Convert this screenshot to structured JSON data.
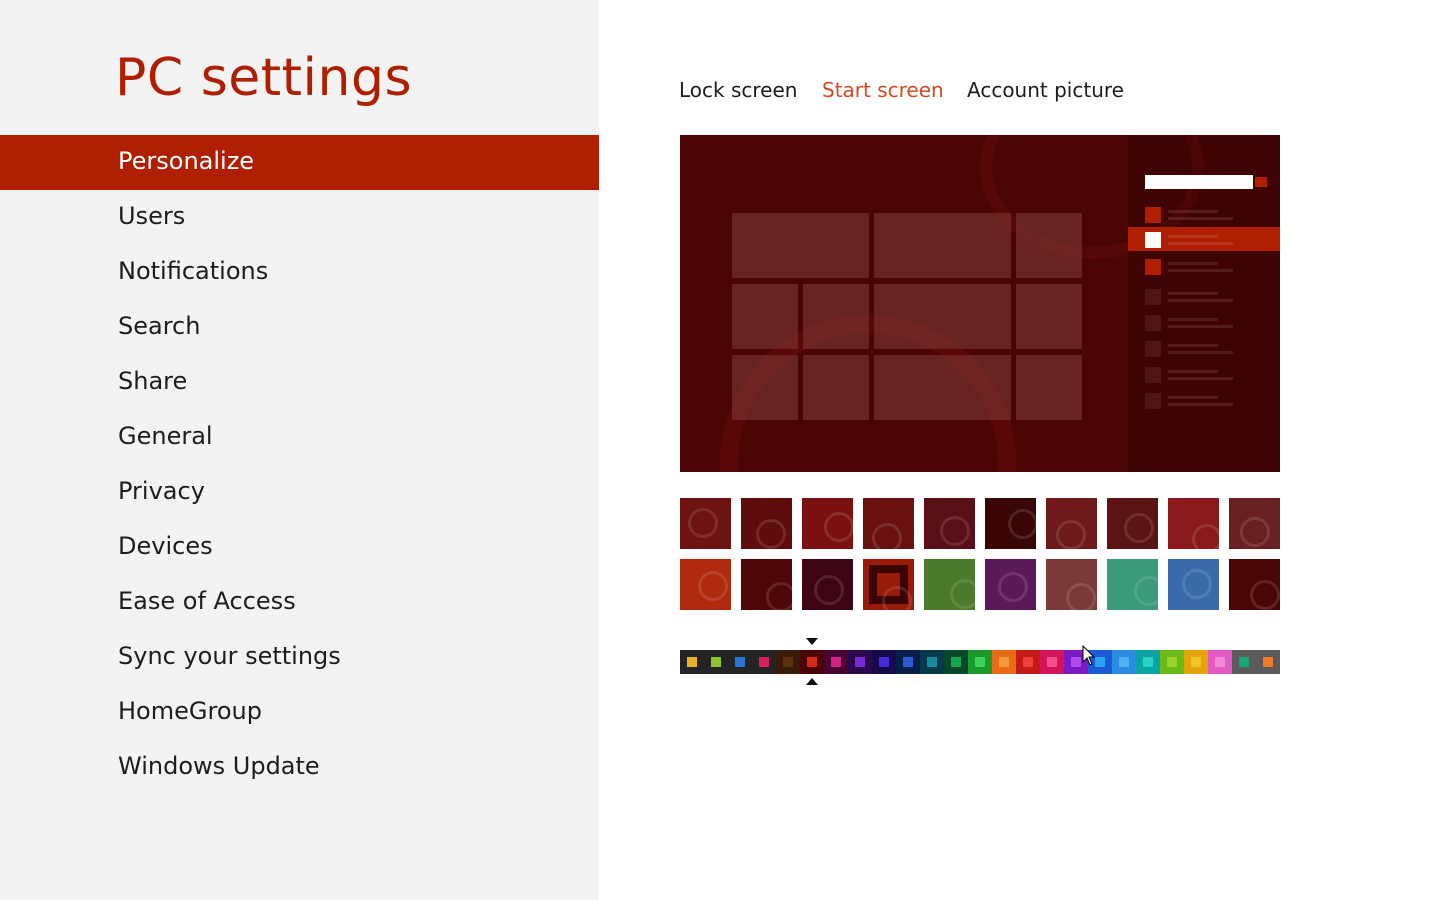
{
  "app": {
    "title": "PC settings"
  },
  "nav": {
    "items": [
      {
        "label": "Personalize",
        "selected": true
      },
      {
        "label": "Users"
      },
      {
        "label": "Notifications"
      },
      {
        "label": "Search"
      },
      {
        "label": "Share"
      },
      {
        "label": "General"
      },
      {
        "label": "Privacy"
      },
      {
        "label": "Devices"
      },
      {
        "label": "Ease of Access"
      },
      {
        "label": "Sync your settings"
      },
      {
        "label": "HomeGroup"
      },
      {
        "label": "Windows Update"
      }
    ]
  },
  "tabs": [
    {
      "label": "Lock screen"
    },
    {
      "label": "Start screen",
      "active": true
    },
    {
      "label": "Account picture"
    }
  ],
  "preview": {
    "background_color": "#4a0404",
    "accent_color": "#b01e00"
  },
  "patterns": [
    {
      "name": "pattern-1",
      "color": "#6e1212"
    },
    {
      "name": "pattern-2",
      "color": "#5e0c0c"
    },
    {
      "name": "pattern-3",
      "color": "#7a1010"
    },
    {
      "name": "pattern-4",
      "color": "#6a1010"
    },
    {
      "name": "pattern-5",
      "color": "#5a0e18"
    },
    {
      "name": "pattern-6",
      "color": "#3a0505"
    },
    {
      "name": "pattern-7",
      "color": "#6e1a1a"
    },
    {
      "name": "pattern-8",
      "color": "#5a1414"
    },
    {
      "name": "pattern-9",
      "color": "#8a1a1a"
    },
    {
      "name": "pattern-10",
      "color": "#6a2020"
    },
    {
      "name": "pattern-11",
      "color": "#b02a10"
    },
    {
      "name": "pattern-12",
      "color": "#4e0606"
    },
    {
      "name": "pattern-13",
      "color": "#3e0414"
    },
    {
      "name": "pattern-14",
      "color": "#9a1a0a"
    },
    {
      "name": "pattern-15",
      "color": "#4a7a2a"
    },
    {
      "name": "pattern-16",
      "color": "#5a1a5a"
    },
    {
      "name": "pattern-17",
      "color": "#7a3a3a"
    },
    {
      "name": "pattern-18",
      "color": "#3a9a7a"
    },
    {
      "name": "pattern-19",
      "color": "#3a6aaa"
    },
    {
      "name": "pattern-20",
      "color": "#4a0606"
    }
  ],
  "selected_pattern_index": 13,
  "color_swatches": [
    {
      "bg": "#242424",
      "dot": "#e3b324"
    },
    {
      "bg": "#242424",
      "dot": "#8dc32e"
    },
    {
      "bg": "#242424",
      "dot": "#2b74d4"
    },
    {
      "bg": "#242424",
      "dot": "#d4205c"
    },
    {
      "bg": "#3a1a08",
      "dot": "#5e3410"
    },
    {
      "bg": "#4a0404",
      "dot": "#d42a1c"
    },
    {
      "bg": "#4a0434",
      "dot": "#d4207e"
    },
    {
      "bg": "#2a0a4a",
      "dot": "#7a2ad4"
    },
    {
      "bg": "#160a4a",
      "dot": "#4a2ad4"
    },
    {
      "bg": "#061e4a",
      "dot": "#2a5ad4"
    },
    {
      "bg": "#063a4a",
      "dot": "#1a8aa4"
    },
    {
      "bg": "#06482a",
      "dot": "#1aa44a"
    },
    {
      "bg": "#1a9a2a",
      "dot": "#3ad45a"
    },
    {
      "bg": "#e86a14",
      "dot": "#f59a3a"
    },
    {
      "bg": "#c41a14",
      "dot": "#f0403a"
    },
    {
      "bg": "#d4145a",
      "dot": "#f2508a"
    },
    {
      "bg": "#7a1ac4",
      "dot": "#b04aef"
    },
    {
      "bg": "#1a5ad4",
      "dot": "#2aa4ef"
    },
    {
      "bg": "#2a8ae4",
      "dot": "#4ab4f5"
    },
    {
      "bg": "#0aa4a4",
      "dot": "#2ad4c4"
    },
    {
      "bg": "#6aba1a",
      "dot": "#9ad42a"
    },
    {
      "bg": "#e4a40a",
      "dot": "#f0c42a"
    },
    {
      "bg": "#e45ac4",
      "dot": "#f28ad4"
    },
    {
      "bg": "#5a5a5a",
      "dot": "#1aa47a"
    },
    {
      "bg": "#5a5a5a",
      "dot": "#f07a2a"
    }
  ],
  "selected_color_index": 5
}
